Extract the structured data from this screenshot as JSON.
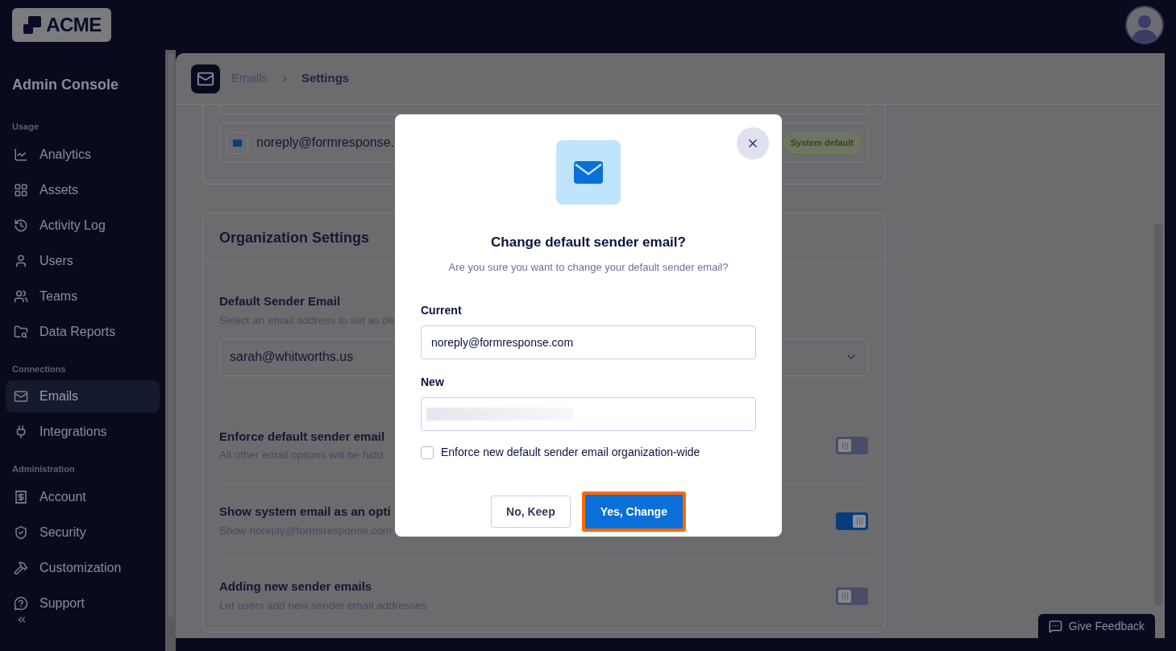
{
  "logo": {
    "text": "ACME"
  },
  "sidebar": {
    "title": "Admin Console",
    "sections": [
      {
        "heading": "Usage",
        "items": [
          {
            "label": "Analytics",
            "selected": false
          },
          {
            "label": "Assets",
            "selected": false
          },
          {
            "label": "Activity Log",
            "selected": false
          },
          {
            "label": "Users",
            "selected": false
          },
          {
            "label": "Teams",
            "selected": false
          },
          {
            "label": "Data Reports",
            "selected": false
          }
        ]
      },
      {
        "heading": "Connections",
        "items": [
          {
            "label": "Emails",
            "selected": true
          },
          {
            "label": "Integrations",
            "selected": false
          }
        ]
      },
      {
        "heading": "Administration",
        "items": [
          {
            "label": "Account",
            "selected": false
          },
          {
            "label": "Security",
            "selected": false
          },
          {
            "label": "Customization",
            "selected": false
          },
          {
            "label": "Support",
            "selected": false
          }
        ]
      }
    ]
  },
  "breadcrumb": [
    "Emails",
    "Settings"
  ],
  "sender_list": {
    "email": "noreply@formresponse.",
    "badge": "System default"
  },
  "org_settings": {
    "title": "Organization Settings",
    "default_sender": {
      "label": "Default Sender Email",
      "description": "Select an email address to set as de",
      "value": "sarah@whitworths.us"
    },
    "toggles": [
      {
        "label": "Enforce default sender email",
        "description": "All other email options will be hidd",
        "on": false
      },
      {
        "label": "Show system email as an opti",
        "description": "Show noreply@formsresponse.com",
        "on": true
      },
      {
        "label": "Adding new sender emails",
        "description": "Let users add new sender email addresses",
        "on": false
      }
    ]
  },
  "feedback_button": "Give Feedback",
  "dialog": {
    "title": "Change default sender email?",
    "subtitle": "Are you sure you want to change your default sender email?",
    "current": {
      "label": "Current",
      "value": "noreply@formresponse.com"
    },
    "new": {
      "label": "New"
    },
    "checkbox": {
      "label": "Enforce new default sender email organization-wide",
      "checked": false
    },
    "buttons": [
      {
        "label": "No, Keep",
        "kind": "secondary"
      },
      {
        "label": "Yes, Change",
        "kind": "primary"
      }
    ]
  }
}
